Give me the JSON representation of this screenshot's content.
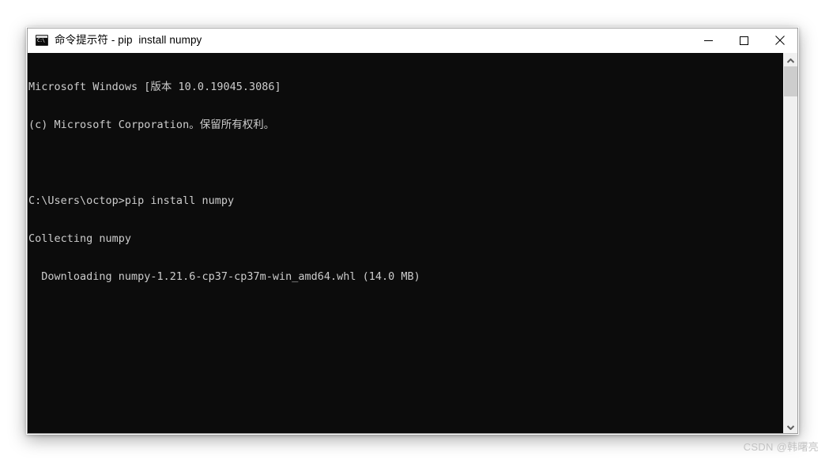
{
  "window": {
    "title": "命令提示符 - pip  install numpy",
    "icon": "cmd-console-icon",
    "controls": {
      "minimize_label": "最小化",
      "maximize_label": "最大化",
      "close_label": "关闭"
    }
  },
  "console": {
    "background_color": "#0c0c0c",
    "text_color": "#cccccc",
    "lines": [
      "Microsoft Windows [版本 10.0.19045.3086]",
      "(c) Microsoft Corporation。保留所有权利。",
      "",
      "C:\\Users\\octop>pip install numpy",
      "Collecting numpy",
      "  Downloading numpy-1.21.6-cp37-cp37m-win_amd64.whl (14.0 MB)"
    ]
  },
  "scrollbar": {
    "up_arrow": "▲",
    "down_arrow": "▼",
    "thumb_position": "top"
  },
  "watermark": {
    "text": "CSDN @韩曙亮"
  }
}
